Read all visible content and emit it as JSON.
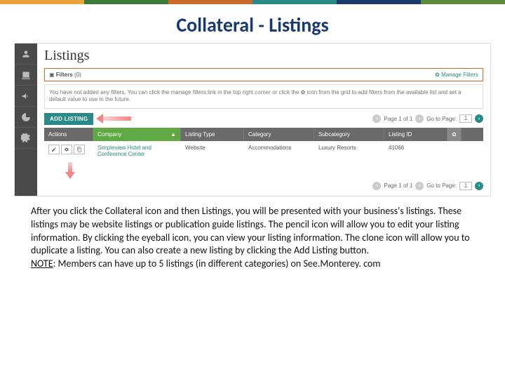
{
  "topbar_colors": [
    "#e8a33d",
    "#3a7a3a",
    "#c96a2b",
    "#2a8a8a",
    "#1a3a6e",
    "#5a8a3a"
  ],
  "slide_title": "Collateral - Listings",
  "page_heading": "Listings",
  "filters": {
    "label": "Filters",
    "count": "(0)",
    "manage": "Manage Filters"
  },
  "info_text": "You have not added any filters. You can click the manage filters link in the top right corner or click the ✿ icon from the grid to add filters from the available list and set a default value to use in the future.",
  "add_listing": "ADD LISTING",
  "pager": {
    "page_label": "Page 1 of 1",
    "goto_label": "Go to Page:",
    "page_value": "1"
  },
  "columns": {
    "actions": "Actions",
    "company": "Company",
    "type": "Listing Type",
    "category": "Category",
    "subcategory": "Subcategory",
    "id": "Listing ID"
  },
  "row": {
    "company": "Simpleview Hotel and Conference Center",
    "type": "Website",
    "category": "Accommodations",
    "subcategory": "Luxury Resorts",
    "id": "41066"
  },
  "body": {
    "p1": "After you click the Collateral icon and then Listings, you will be presented with your business's listings.  These listings may be website listings or publication guide listings.  The pencil icon will allow you to edit your listing information.  By clicking the eyeball icon, you can view your listing information.  The clone icon will allow you to duplicate a listing.  You can also create a new listing by clicking the Add Listing button.",
    "note_label": "NOTE",
    "note_text": ":  Members can have up to 5 listings (in different categories) on See.Monterey. com"
  }
}
